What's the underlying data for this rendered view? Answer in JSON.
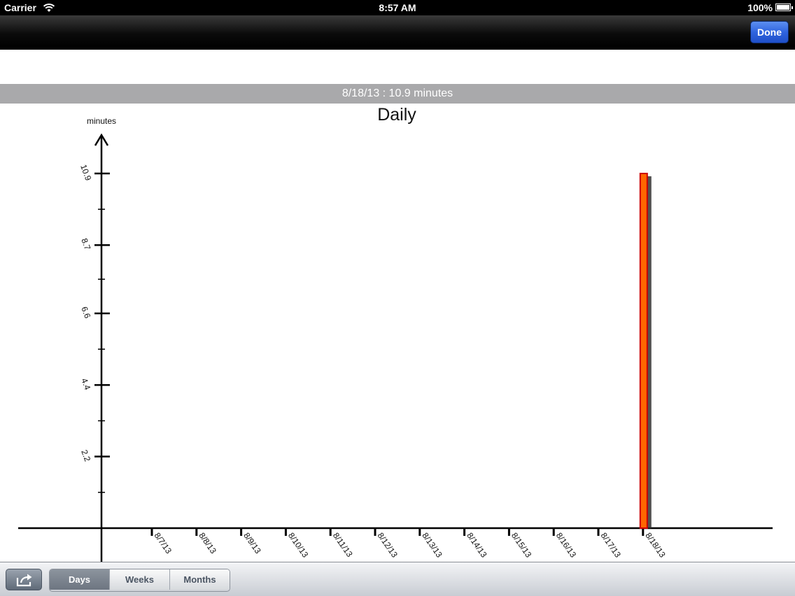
{
  "status": {
    "carrier": "Carrier",
    "time": "8:57 AM",
    "battery": "100%"
  },
  "nav": {
    "done_label": "Done"
  },
  "info": {
    "selection": "8/18/13 : 10.9 minutes"
  },
  "toolbar": {
    "segments": [
      {
        "label": "Days",
        "active": true
      },
      {
        "label": "Weeks",
        "active": false
      },
      {
        "label": "Months",
        "active": false
      }
    ]
  },
  "chart_data": {
    "type": "bar",
    "title": "Daily",
    "ylabel": "minutes",
    "xlabel": "",
    "categories": [
      "8/7/13",
      "8/8/13",
      "8/9/13",
      "8/10/13",
      "8/11/13",
      "8/12/13",
      "8/13/13",
      "8/14/13",
      "8/15/13",
      "8/16/13",
      "8/17/13",
      "8/18/13"
    ],
    "values": [
      0,
      0,
      0,
      0,
      0,
      0,
      0,
      0,
      0,
      0,
      0,
      10.9
    ],
    "y_ticks": [
      "2.2",
      "4.4",
      "6.6",
      "8.7",
      "10.9"
    ],
    "ylim": [
      0,
      10.9
    ],
    "bar_color": "#ff6600",
    "bar_border_color": "#cc0000"
  }
}
